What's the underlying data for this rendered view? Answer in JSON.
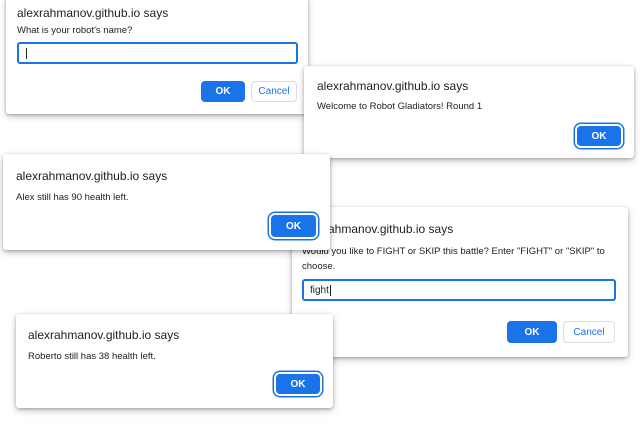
{
  "dialogs": {
    "robot_name": {
      "title": "alexrahmanov.github.io says",
      "message": "What is your robot's name?",
      "input_value": "",
      "ok_label": "OK",
      "cancel_label": "Cancel"
    },
    "welcome": {
      "title": "alexrahmanov.github.io says",
      "message": "Welcome to Robot Gladiators! Round 1",
      "ok_label": "OK"
    },
    "alex_health": {
      "title": "alexrahmanov.github.io says",
      "message": "Alex still has 90 health left.",
      "ok_label": "OK"
    },
    "fight_or_skip": {
      "title": "alexrahmanov.github.io says",
      "message": "Would you like to FIGHT or SKIP this battle? Enter \"FIGHT\" or \"SKIP\" to choose.",
      "input_value": "fight",
      "ok_label": "OK",
      "cancel_label": "Cancel"
    },
    "roberto_health": {
      "title": "alexrahmanov.github.io says",
      "message": "Roberto still has 38 health left.",
      "ok_label": "OK"
    }
  },
  "colors": {
    "accent": "#1a73e8",
    "text": "#202124",
    "border": "#dadce0"
  }
}
